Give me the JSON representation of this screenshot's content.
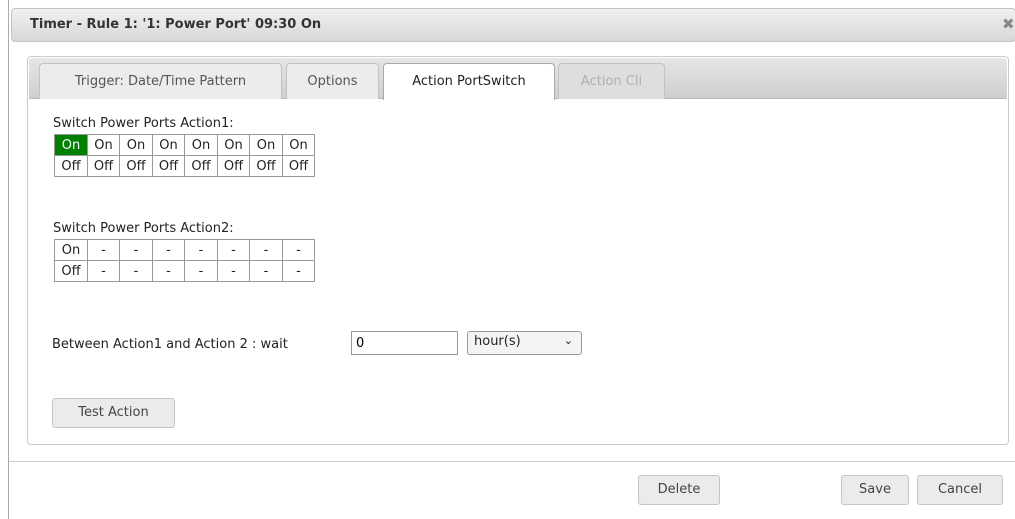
{
  "dialog": {
    "title": "Timer - Rule 1: '1: Power Port' 09:30 On",
    "close_icon": "close-icon"
  },
  "tabs": [
    {
      "label": "Trigger: Date/Time Pattern",
      "state": "normal"
    },
    {
      "label": "Options",
      "state": "normal"
    },
    {
      "label": "Action PortSwitch",
      "state": "active"
    },
    {
      "label": "Action Cli",
      "state": "disabled"
    }
  ],
  "action1": {
    "label": "Switch Power Ports Action1:",
    "on_row": [
      "On",
      "On",
      "On",
      "On",
      "On",
      "On",
      "On",
      "On"
    ],
    "off_row": [
      "Off",
      "Off",
      "Off",
      "Off",
      "Off",
      "Off",
      "Off",
      "Off"
    ],
    "active_on_index": 0,
    "active_color": "#008000"
  },
  "action2": {
    "label": "Switch Power Ports Action2:",
    "on_row": [
      "On",
      "-",
      "-",
      "-",
      "-",
      "-",
      "-",
      "-"
    ],
    "off_row": [
      "Off",
      "-",
      "-",
      "-",
      "-",
      "-",
      "-",
      "-"
    ]
  },
  "wait": {
    "label": "Between Action1 and Action 2 : wait",
    "value": "0",
    "unit": "hour(s)"
  },
  "buttons": {
    "test": "Test Action",
    "delete": "Delete",
    "save": "Save",
    "cancel": "Cancel"
  }
}
